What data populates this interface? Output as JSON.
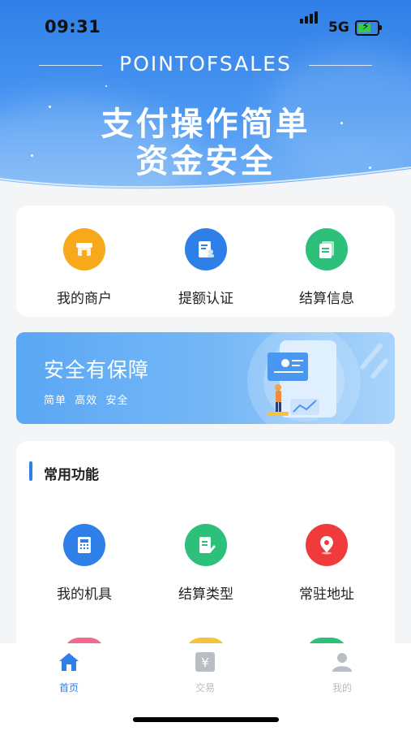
{
  "status_bar": {
    "time": "09:31",
    "network": "5G"
  },
  "hero": {
    "brand": "POINTOFSALES",
    "slogan_line1": "支付操作简单",
    "slogan_line2": "资金安全"
  },
  "quick_actions": [
    {
      "label": "我的商户",
      "icon": "store-icon",
      "color": "#f7a81b"
    },
    {
      "label": "提额认证",
      "icon": "id-card-icon",
      "color": "#2f7fe8"
    },
    {
      "label": "结算信息",
      "icon": "document-icon",
      "color": "#2cc07a"
    }
  ],
  "banner": {
    "title": "安全有保障",
    "subtitle": "简单  高效  安全"
  },
  "common": {
    "title": "常用功能",
    "items": [
      {
        "label": "我的机具",
        "icon": "calculator-icon",
        "color": "#2f7fe8"
      },
      {
        "label": "结算类型",
        "icon": "edit-document-icon",
        "color": "#2cc07a"
      },
      {
        "label": "常驻地址",
        "icon": "location-pin-icon",
        "color": "#ef3b3b"
      }
    ]
  },
  "tabbar": [
    {
      "label": "首页",
      "icon": "home-icon",
      "active": true
    },
    {
      "label": "交易",
      "icon": "yuan-icon",
      "active": false
    },
    {
      "label": "我的",
      "icon": "user-icon",
      "active": false
    }
  ],
  "colors": {
    "accent": "#2f7fe8",
    "inactive": "#b9bdc4"
  }
}
